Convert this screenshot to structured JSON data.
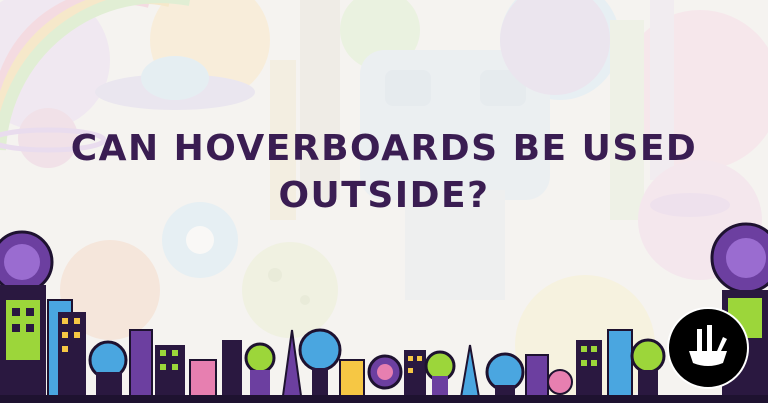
{
  "article": {
    "title_line1": "CAN HOVERBOARDS BE USED",
    "title_line2": "OUTSIDE?"
  },
  "logo": {
    "icon": "circle-logo-icon"
  },
  "colors": {
    "title": "#3a1d52",
    "logo_bg": "#000000",
    "accent_green": "#9cd63a",
    "accent_purple": "#6c3fa0",
    "accent_blue": "#4aa6e0",
    "accent_yellow": "#f6c744",
    "accent_pink": "#e77fb0"
  }
}
